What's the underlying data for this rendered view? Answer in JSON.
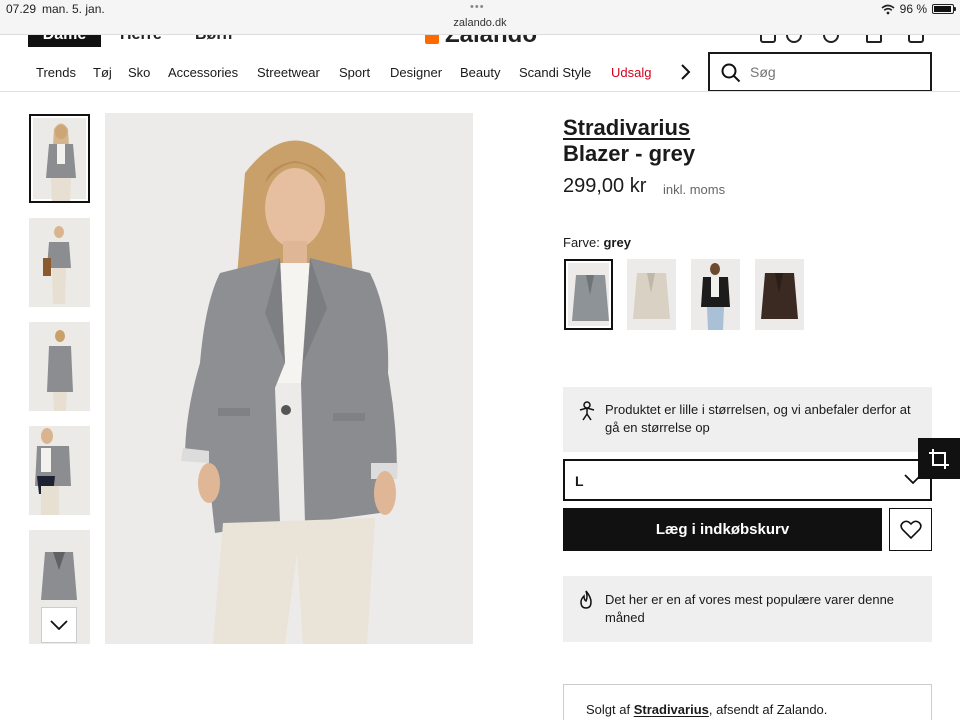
{
  "status_bar": {
    "time": "07.29",
    "date": "man. 5. jan.",
    "url": "zalando.dk",
    "battery": "96 %",
    "battery_level": 0.96
  },
  "header": {
    "tabs": [
      "Dame",
      "Herre",
      "Børn"
    ],
    "logo_text": "Zalando"
  },
  "nav": {
    "items": [
      "Trends",
      "Tøj",
      "Sko",
      "Accessories",
      "Streetwear",
      "Sport",
      "Designer",
      "Beauty",
      "Scandi Style",
      "Udsalg"
    ],
    "sale_color": "#d0021b",
    "search_placeholder": "Søg"
  },
  "product": {
    "brand": "Stradivarius",
    "name": "Blazer - grey",
    "price": "299,00 kr",
    "vat_note": "inkl. moms",
    "color_label": "Farve:",
    "color_value": "grey",
    "fit_advice": "Produktet er lille i størrelsen, og vi anbefaler derfor at gå en størrelse op",
    "selected_size": "L",
    "add_to_cart": "Læg i indkøbskurv",
    "popular_note": "Det her er en af vores mest populære varer denne måned",
    "sold_by_prefix": "Solgt af",
    "seller": "Stradivarius",
    "sold_by_suffix": ", afsendt af Zalando."
  },
  "colors": {
    "accent": "#ff6900",
    "primary_button": "#111111",
    "info_box_bg": "#efefef"
  },
  "icons": [
    "search-icon",
    "chevron-right-icon",
    "chevron-down-icon",
    "fit-icon",
    "heart-icon",
    "flame-icon",
    "compare-icon"
  ]
}
